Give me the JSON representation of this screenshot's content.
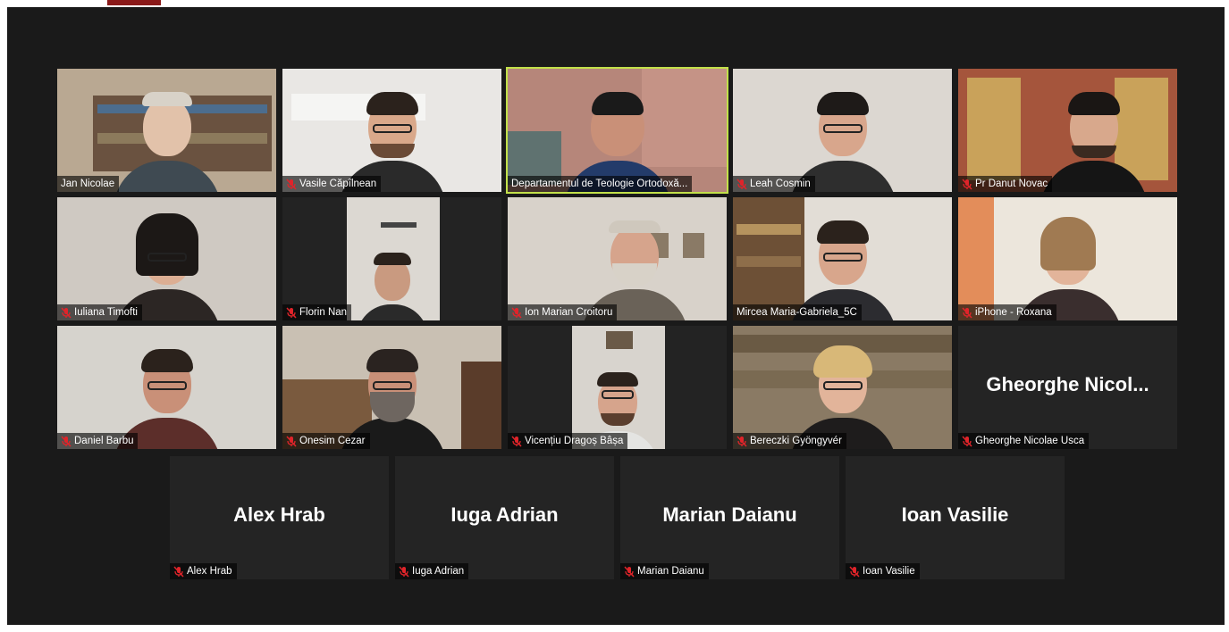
{
  "app": {
    "brand_color": "#8b1a1a",
    "active_speaker_border": "#c2e04a",
    "muted_icon_color": "#e0242a"
  },
  "participants": [
    {
      "name": "Jan Nicolae",
      "muted": false
    },
    {
      "name": "Vasile Căpîlnean",
      "muted": true
    },
    {
      "name": "Departamentul de Teologie Ortodoxă...",
      "muted": false,
      "active_speaker": true
    },
    {
      "name": "Leah Cosmin",
      "muted": true
    },
    {
      "name": "Pr Danut Novac",
      "muted": true
    },
    {
      "name": "Iuliana Timofti",
      "muted": true
    },
    {
      "name": "Florin Nan",
      "muted": true
    },
    {
      "name": "Ion Marian Croitoru",
      "muted": true
    },
    {
      "name": "Mircea Maria-Gabriela_5C",
      "muted": false
    },
    {
      "name": "iPhone - Roxana",
      "muted": true
    },
    {
      "name": "Daniel Barbu",
      "muted": true
    },
    {
      "name": "Onesim Cezar",
      "muted": true
    },
    {
      "name": "Vicențiu Dragoș Bâșa",
      "muted": true
    },
    {
      "name": "Bereczki Gyöngyvér",
      "muted": true
    },
    {
      "name": "Gheorghe Nicolae Usca",
      "muted": true,
      "camera_off": true,
      "display_name": "Gheorghe  Nicol..."
    },
    {
      "name": "Alex Hrab",
      "muted": true,
      "camera_off": true,
      "display_name": "Alex Hrab"
    },
    {
      "name": "Iuga Adrian",
      "muted": true,
      "camera_off": true,
      "display_name": "Iuga Adrian"
    },
    {
      "name": "Marian Daianu",
      "muted": true,
      "camera_off": true,
      "display_name": "Marian Daianu"
    },
    {
      "name": "Ioan Vasilie",
      "muted": true,
      "camera_off": true,
      "display_name": "Ioan Vasilie"
    }
  ]
}
